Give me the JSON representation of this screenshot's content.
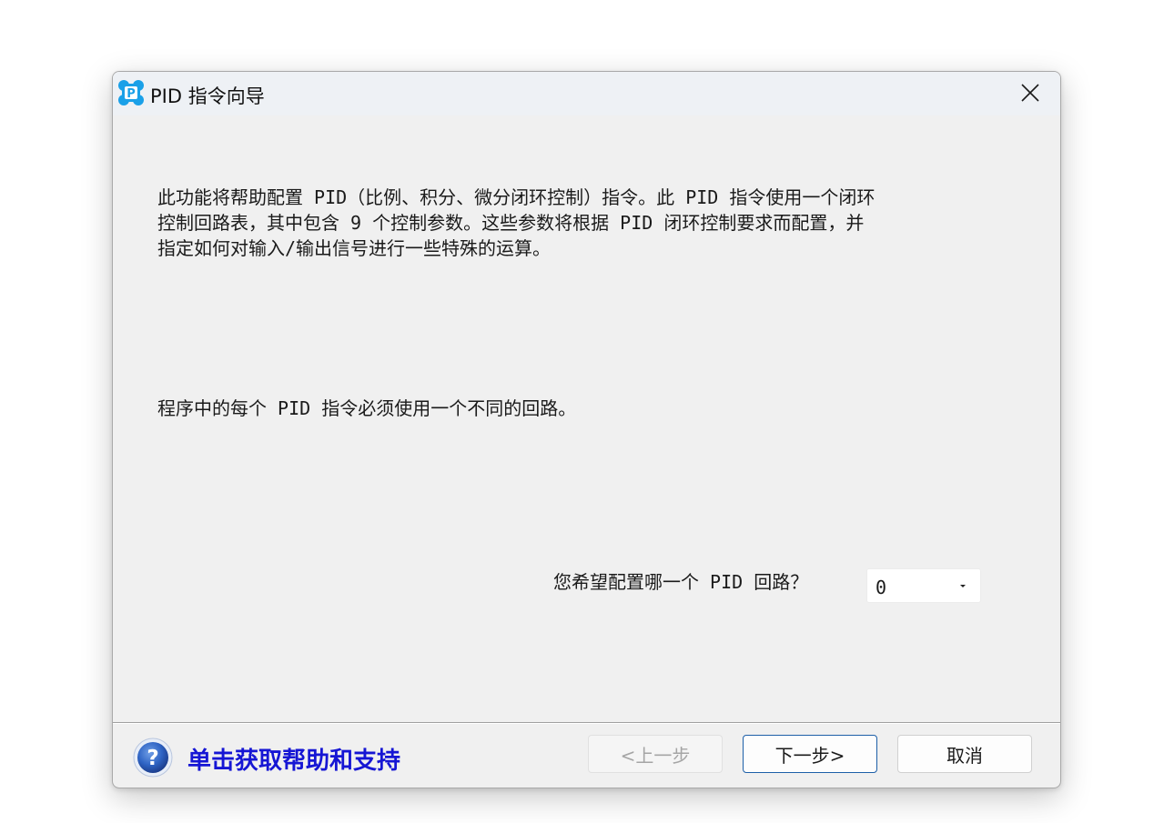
{
  "window": {
    "title": "PID 指令向导",
    "app_icon_letter": "P"
  },
  "content": {
    "paragraph1": "此功能将帮助配置 PID（比例、积分、微分闭环控制）指令。此 PID 指令使用一个闭环\n控制回路表，其中包含 9 个控制参数。这些参数将根据 PID 闭环控制要求而配置，并\n指定如何对输入/输出信号进行一些特殊的运算。",
    "paragraph2": "程序中的每个 PID 指令必须使用一个不同的回路。",
    "loop_question": "您希望配置哪一个 PID 回路？",
    "loop_select_value": "0"
  },
  "footer": {
    "help_link": "单击获取帮助和支持",
    "help_icon_glyph": "?",
    "prev_button": "<上一步",
    "next_button": "下一步>",
    "cancel_button": "取消"
  },
  "colors": {
    "help_link": "#1616d4",
    "next_button_border": "#1d5fa8",
    "app_icon": "#1aa0e8"
  }
}
